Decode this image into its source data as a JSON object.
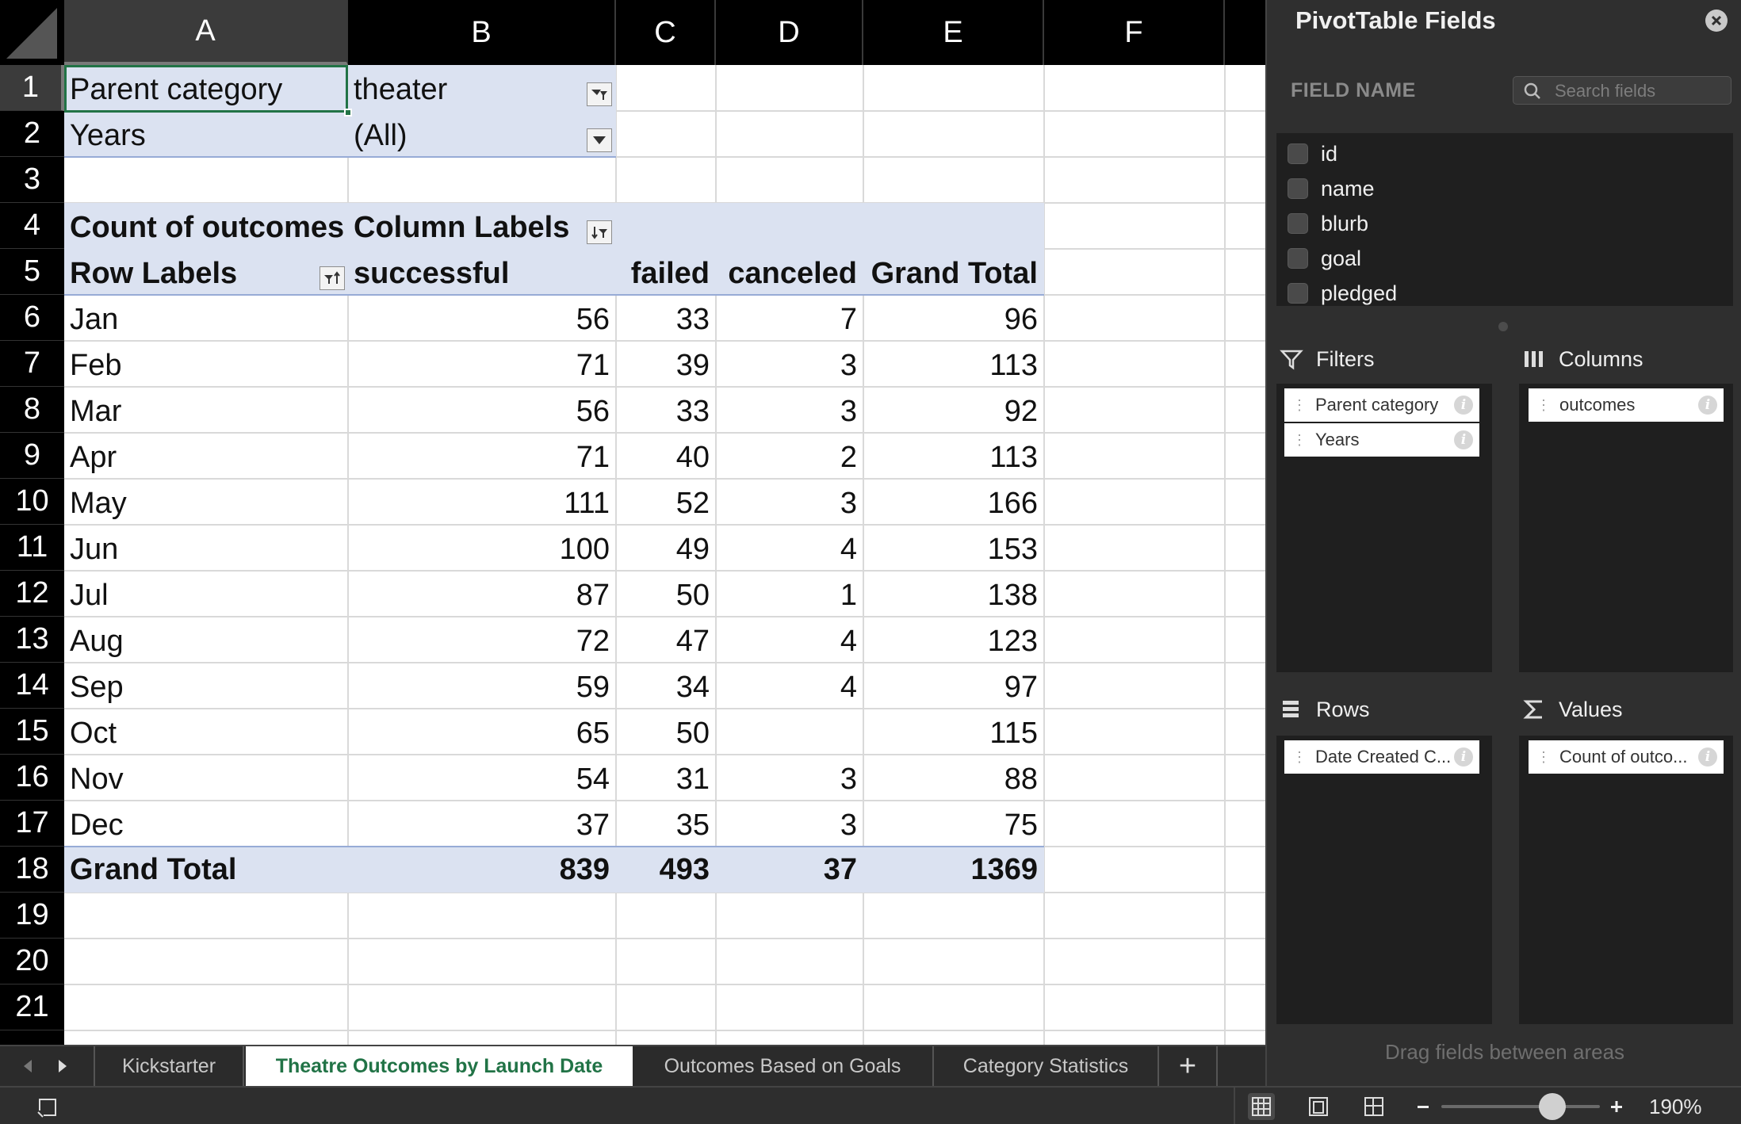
{
  "columns": [
    "A",
    "B",
    "C",
    "D",
    "E",
    "F"
  ],
  "rows": [
    "1",
    "2",
    "3",
    "4",
    "5",
    "6",
    "7",
    "8",
    "9",
    "10",
    "11",
    "12",
    "13",
    "14",
    "15",
    "16",
    "17",
    "18",
    "19",
    "20",
    "21"
  ],
  "filters": [
    {
      "label": "Parent category",
      "value": "theater"
    },
    {
      "label": "Years",
      "value": "(All)"
    }
  ],
  "pivot": {
    "value_header": "Count of outcomes",
    "column_labels": "Column Labels",
    "row_labels": "Row Labels",
    "col_headers": [
      "successful",
      "failed",
      "canceled",
      "Grand Total"
    ],
    "body": [
      {
        "label": "Jan",
        "successful": "56",
        "failed": "33",
        "canceled": "7",
        "total": "96"
      },
      {
        "label": "Feb",
        "successful": "71",
        "failed": "39",
        "canceled": "3",
        "total": "113"
      },
      {
        "label": "Mar",
        "successful": "56",
        "failed": "33",
        "canceled": "3",
        "total": "92"
      },
      {
        "label": "Apr",
        "successful": "71",
        "failed": "40",
        "canceled": "2",
        "total": "113"
      },
      {
        "label": "May",
        "successful": "111",
        "failed": "52",
        "canceled": "3",
        "total": "166"
      },
      {
        "label": "Jun",
        "successful": "100",
        "failed": "49",
        "canceled": "4",
        "total": "153"
      },
      {
        "label": "Jul",
        "successful": "87",
        "failed": "50",
        "canceled": "1",
        "total": "138"
      },
      {
        "label": "Aug",
        "successful": "72",
        "failed": "47",
        "canceled": "4",
        "total": "123"
      },
      {
        "label": "Sep",
        "successful": "59",
        "failed": "34",
        "canceled": "4",
        "total": "97"
      },
      {
        "label": "Oct",
        "successful": "65",
        "failed": "50",
        "canceled": "",
        "total": "115"
      },
      {
        "label": "Nov",
        "successful": "54",
        "failed": "31",
        "canceled": "3",
        "total": "88"
      },
      {
        "label": "Dec",
        "successful": "37",
        "failed": "35",
        "canceled": "3",
        "total": "75"
      }
    ],
    "grand_total": {
      "label": "Grand Total",
      "successful": "839",
      "failed": "493",
      "canceled": "37",
      "total": "1369"
    }
  },
  "tabs": [
    "Kickstarter",
    "Theatre Outcomes by Launch Date",
    "Outcomes Based on Goals",
    "Category Statistics"
  ],
  "active_tab": "Theatre Outcomes by Launch Date",
  "tab_add": "+",
  "zoom": "190%",
  "zoom_level_fraction": 0.7,
  "pane": {
    "title": "PivotTable Fields",
    "field_name_label": "FIELD NAME",
    "search_placeholder": "Search fields",
    "fields": [
      "id",
      "name",
      "blurb",
      "goal",
      "pledged"
    ],
    "areas": {
      "filters": {
        "label": "Filters",
        "items": [
          "Parent category",
          "Years"
        ]
      },
      "columns": {
        "label": "Columns",
        "items": [
          "outcomes"
        ]
      },
      "rows": {
        "label": "Rows",
        "items": [
          "Date Created C..."
        ]
      },
      "values": {
        "label": "Values",
        "items": [
          "Count of outco..."
        ]
      }
    },
    "drag_hint": "Drag fields between areas"
  },
  "colors": {
    "accent": "#217346",
    "pivot_band": "#dbe2f1",
    "pivot_line": "#97abd6",
    "pane_bg": "#2f2f2f"
  },
  "icons": {
    "close": "close-icon",
    "search": "search-icon",
    "filter": "filter-icon",
    "columns": "columns-icon",
    "rows": "rows-icon",
    "values": "sigma-icon",
    "info": "info-icon",
    "dropdown": "dropdown-arrow-icon"
  }
}
